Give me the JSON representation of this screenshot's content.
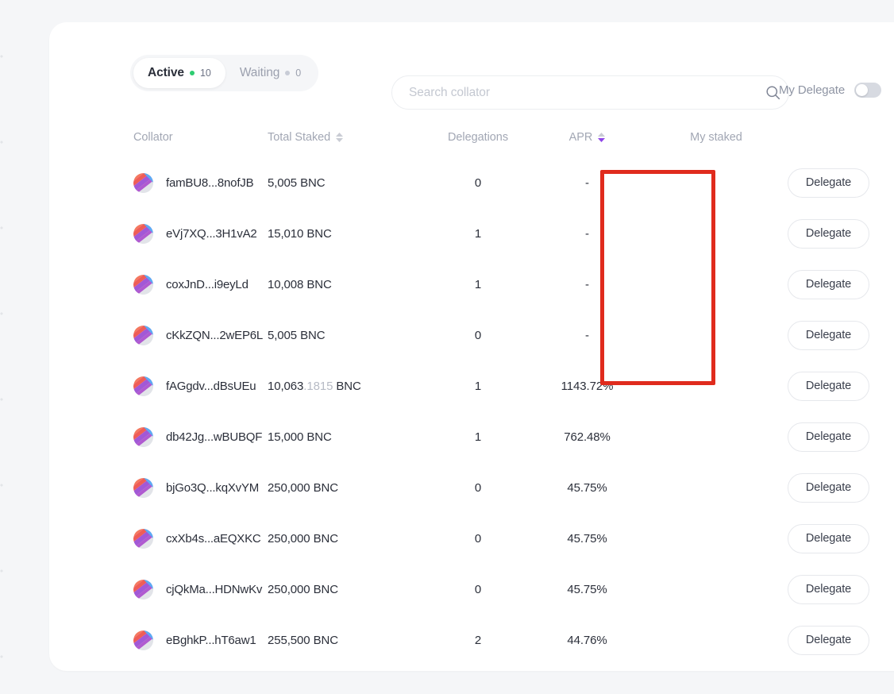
{
  "toolbar": {
    "tabs": [
      {
        "label": "Active",
        "count": "10",
        "active": true
      },
      {
        "label": "Waiting",
        "count": "0",
        "active": false
      }
    ],
    "search": {
      "placeholder": "Search collator",
      "value": "",
      "icon": "search-icon"
    },
    "my_delegate": {
      "label": "My Delegate",
      "state": "off"
    }
  },
  "table": {
    "headers": {
      "collator": "Collator",
      "total_staked": "Total Staked",
      "delegations": "Delegations",
      "apr": "APR",
      "my_staked": "My staked"
    },
    "sort": {
      "total_staked": "none",
      "apr": "desc",
      "active_color": "#8e44e8",
      "inactive_color": "#c9ccd4"
    },
    "action_label": "Delegate",
    "rows": [
      {
        "collator": "famBU8...8nofJB",
        "total_staked_int": "5,005",
        "total_staked_dec": "",
        "unit": "BNC",
        "delegations": "0",
        "apr": "-",
        "my_staked": "",
        "action": "Delegate"
      },
      {
        "collator": "eVj7XQ...3H1vA2",
        "total_staked_int": "15,010",
        "total_staked_dec": "",
        "unit": "BNC",
        "delegations": "1",
        "apr": "-",
        "my_staked": "",
        "action": "Delegate"
      },
      {
        "collator": "coxJnD...i9eyLd",
        "total_staked_int": "10,008",
        "total_staked_dec": "",
        "unit": "BNC",
        "delegations": "1",
        "apr": "-",
        "my_staked": "",
        "action": "Delegate"
      },
      {
        "collator": "cKkZQN...2wEP6L",
        "total_staked_int": "5,005",
        "total_staked_dec": "",
        "unit": "BNC",
        "delegations": "0",
        "apr": "-",
        "my_staked": "",
        "action": "Delegate"
      },
      {
        "collator": "fAGgdv...dBsUEu",
        "total_staked_int": "10,063",
        "total_staked_dec": ".1815",
        "unit": "BNC",
        "delegations": "1",
        "apr": "1143.72%",
        "my_staked": "",
        "action": "Delegate"
      },
      {
        "collator": "db42Jg...wBUBQF",
        "total_staked_int": "15,000",
        "total_staked_dec": "",
        "unit": "BNC",
        "delegations": "1",
        "apr": "762.48%",
        "my_staked": "",
        "action": "Delegate"
      },
      {
        "collator": "bjGo3Q...kqXvYM",
        "total_staked_int": "250,000",
        "total_staked_dec": "",
        "unit": "BNC",
        "delegations": "0",
        "apr": "45.75%",
        "my_staked": "",
        "action": "Delegate"
      },
      {
        "collator": "cxXb4s...aEQXKC",
        "total_staked_int": "250,000",
        "total_staked_dec": "",
        "unit": "BNC",
        "delegations": "0",
        "apr": "45.75%",
        "my_staked": "",
        "action": "Delegate"
      },
      {
        "collator": "cjQkMa...HDNwKv",
        "total_staked_int": "250,000",
        "total_staked_dec": "",
        "unit": "BNC",
        "delegations": "0",
        "apr": "45.75%",
        "my_staked": "",
        "action": "Delegate"
      },
      {
        "collator": "eBghkP...hT6aw1",
        "total_staked_int": "255,500",
        "total_staked_dec": "",
        "unit": "BNC",
        "delegations": "2",
        "apr": "44.76%",
        "my_staked": "",
        "action": "Delegate"
      }
    ]
  },
  "annotation": {
    "apr_highlight_color": "#e02b1d"
  }
}
